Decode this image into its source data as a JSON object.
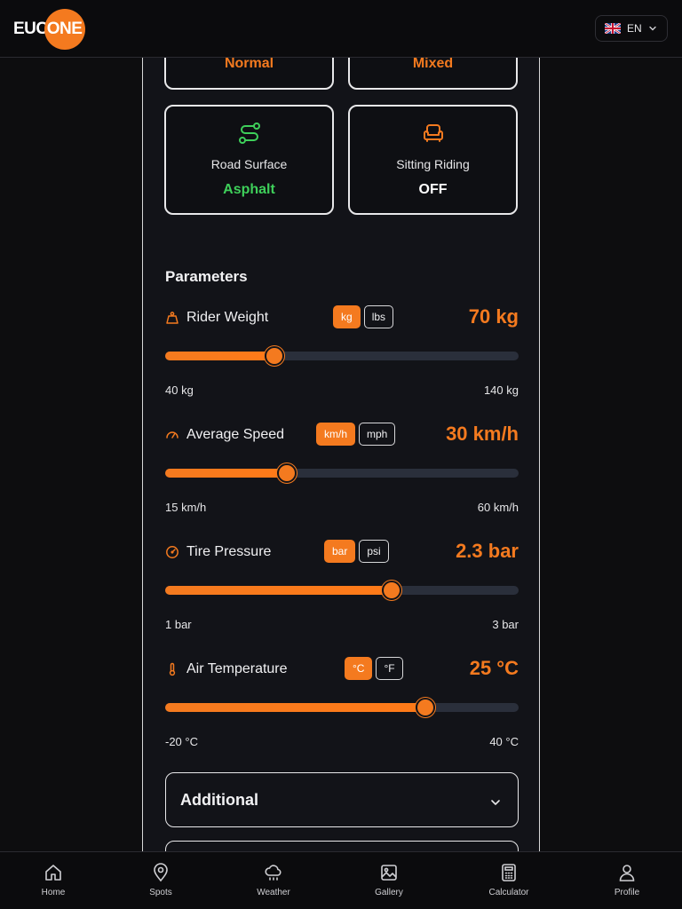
{
  "header": {
    "logo_left": "EUC",
    "logo_right": "ONE",
    "language": "EN",
    "icons": [
      "uk-flag-icon",
      "chevron-down-icon"
    ]
  },
  "cards_top": [
    {
      "value": "Normal"
    },
    {
      "value": "Mixed"
    }
  ],
  "cards": [
    {
      "icon": "route-icon",
      "label": "Road Surface",
      "value": "Asphalt",
      "value_color": "#3ecf5a",
      "icon_color": "#3ecf5a"
    },
    {
      "icon": "seat-icon",
      "label": "Sitting Riding",
      "value": "OFF",
      "value_color": "#ffffff",
      "icon_color": "#f47a1f"
    }
  ],
  "parameters": {
    "title": "Parameters",
    "items": [
      {
        "icon": "weight-icon",
        "label": "Rider Weight",
        "units": [
          "kg",
          "lbs"
        ],
        "active_unit": "kg",
        "value": "70 kg",
        "min": "40 kg",
        "max": "140 kg",
        "level": 0.31
      },
      {
        "icon": "speedometer-icon",
        "label": "Average Speed",
        "units": [
          "km/h",
          "mph"
        ],
        "active_unit": "km/h",
        "value": "30 km/h",
        "min": "15 km/h",
        "max": "60 km/h",
        "level": 0.345
      },
      {
        "icon": "gauge-icon",
        "label": "Tire Pressure",
        "units": [
          "bar",
          "psi"
        ],
        "active_unit": "bar",
        "value": "2.3 bar",
        "min": "1 bar",
        "max": "3 bar",
        "level": 0.64
      },
      {
        "icon": "thermometer-icon",
        "label": "Air Temperature",
        "units": [
          "°C",
          "°F"
        ],
        "active_unit": "°C",
        "value": "25 °C",
        "min": "-20 °C",
        "max": "40 °C",
        "level": 0.735
      }
    ]
  },
  "additional": {
    "label": "Additional"
  },
  "nav": [
    {
      "icon": "home-icon",
      "label": "Home"
    },
    {
      "icon": "map-pin-icon",
      "label": "Spots"
    },
    {
      "icon": "cloud-rain-icon",
      "label": "Weather"
    },
    {
      "icon": "image-icon",
      "label": "Gallery"
    },
    {
      "icon": "calculator-icon",
      "label": "Calculator"
    },
    {
      "icon": "user-icon",
      "label": "Profile"
    }
  ],
  "colors": {
    "accent": "#f47a1f",
    "success": "#3ecf5a",
    "background": "#121318"
  }
}
